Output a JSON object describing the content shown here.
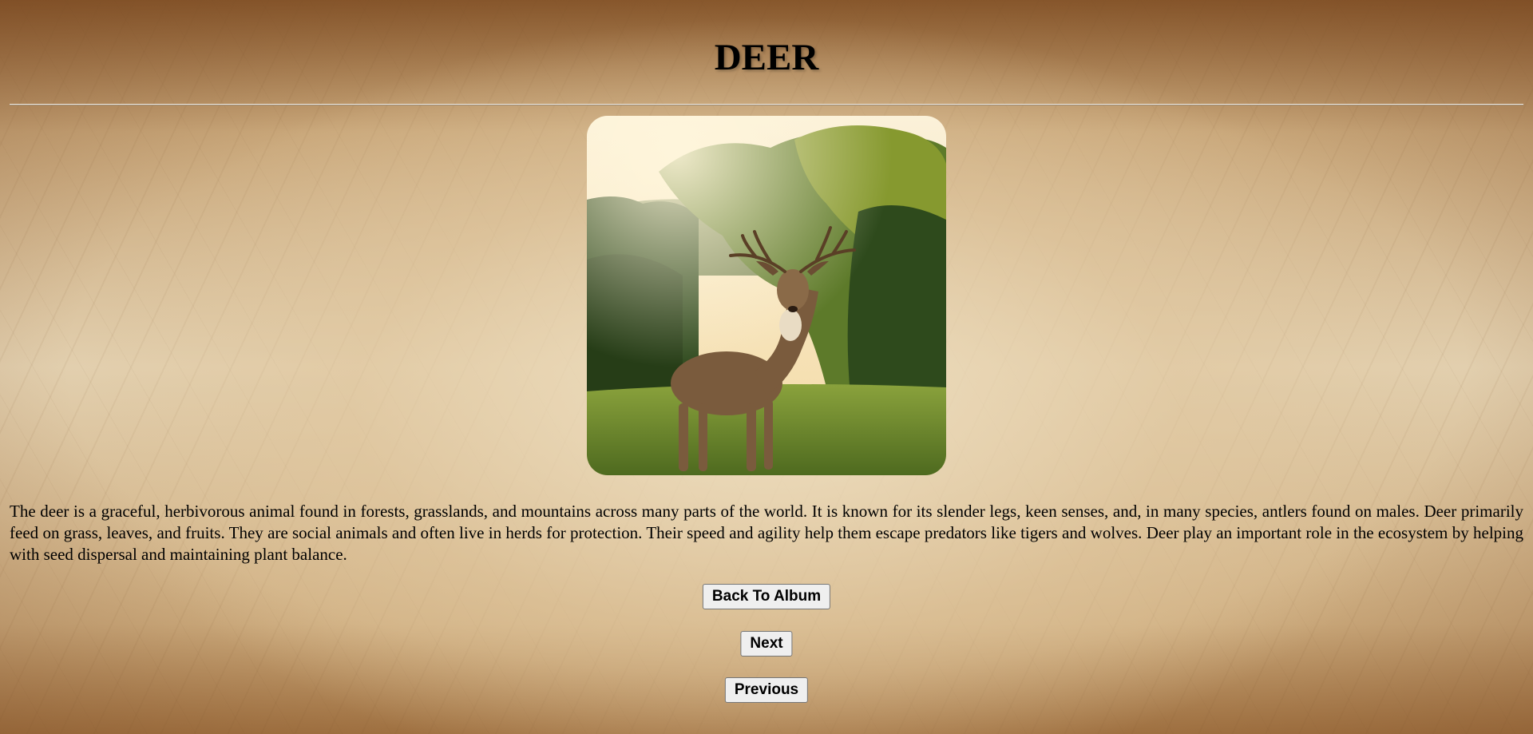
{
  "page": {
    "title": "DEER",
    "description": "The deer is a graceful, herbivorous animal found in forests, grasslands, and mountains across many parts of the world. It is known for its slender legs, keen senses, and, in many species, antlers found on males. Deer primarily feed on grass, leaves, and fruits. They are social animals and often live in herds for protection. Their speed and agility help them escape predators like tigers and wolves. Deer play an important role in the ecosystem by helping with seed dispersal and maintaining plant balance."
  },
  "image": {
    "subject": "deer standing on grass with trees and sunset sky"
  },
  "buttons": {
    "back_label": "Back To Album",
    "next_label": "Next",
    "previous_label": "Previous"
  },
  "colors": {
    "background": "#d9c29a",
    "text": "#000000",
    "button_bg": "#efefef",
    "button_border": "#767676"
  }
}
